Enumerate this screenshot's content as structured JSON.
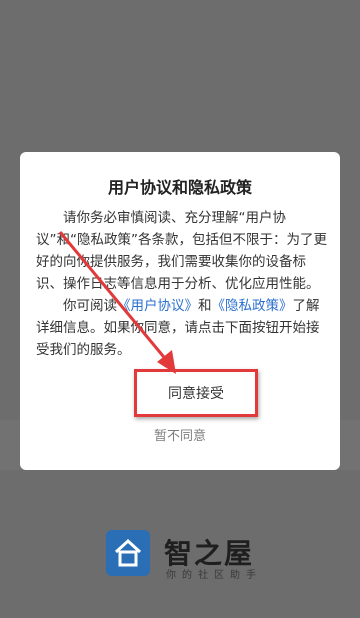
{
  "app": {
    "brand_name": "智之屋",
    "brand_slogan": "你的社区助手"
  },
  "dialog": {
    "title": "用户协议和隐私政策",
    "paragraph1": "请你务必审慎阅读、充分理解“用户协议”和“隐私政策”各条款，包括但不限于：为了更好的向你提供服务，我们需要收集你的设备标识、操作日志等信息用于分析、优化应用性能。",
    "p2_prefix": "你可阅读",
    "link_user_agreement": "《用户协议》",
    "p2_and": "和",
    "link_privacy_policy": "《隐私政策》",
    "p2_suffix": "了解详细信息。如果你同意，请点击下面按钮开始接受我们的服务。",
    "agree_label": "同意接受",
    "disagree_label": "暂不同意"
  },
  "colors": {
    "accent_annotation": "#e23a3a",
    "link": "#2a6fd0",
    "brand_blue": "#2a6fb6"
  },
  "icons": {
    "brand_logo": "house-icon",
    "annotation": "red-arrow"
  }
}
